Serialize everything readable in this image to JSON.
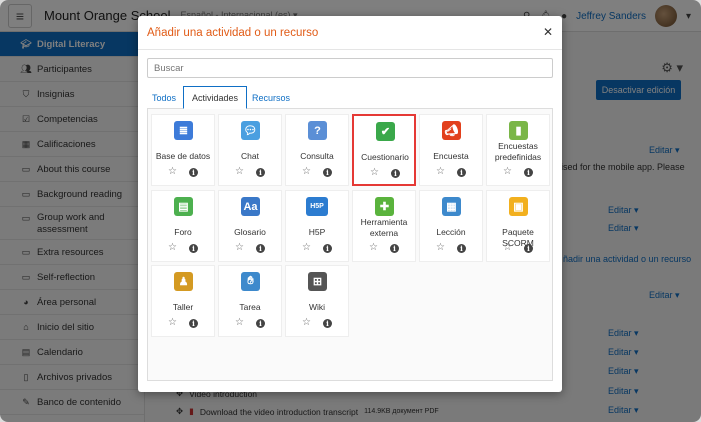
{
  "navbar": {
    "site_name": "Mount Orange School",
    "language": "Español - Internacional (es) ▾",
    "user": "Jeffrey Sanders"
  },
  "sidebar": {
    "items": [
      {
        "label": "Digital Literacy",
        "icon": "graduation-cap-icon",
        "active": true
      },
      {
        "label": "Participantes",
        "icon": "users-icon"
      },
      {
        "label": "Insignias",
        "icon": "shield-icon"
      },
      {
        "label": "Competencias",
        "icon": "check-square-icon"
      },
      {
        "label": "Calificaciones",
        "icon": "table-icon"
      },
      {
        "label": "About this course",
        "icon": "folder-icon"
      },
      {
        "label": "Background reading",
        "icon": "folder-icon"
      },
      {
        "label": "Group work and assessment",
        "icon": "folder-icon"
      },
      {
        "label": "Extra resources",
        "icon": "folder-icon"
      },
      {
        "label": "Self-reflection",
        "icon": "folder-icon"
      },
      {
        "label": "Área personal",
        "icon": "dashboard-icon"
      },
      {
        "label": "Inicio del sitio",
        "icon": "home-icon"
      },
      {
        "label": "Calendario",
        "icon": "calendar-icon"
      },
      {
        "label": "Archivos privados",
        "icon": "file-icon"
      },
      {
        "label": "Banco de contenido",
        "icon": "brush-icon"
      }
    ]
  },
  "background": {
    "edit_mode_button": "Desactivar edición",
    "edit_label": "Editar ▾",
    "mobile_text": "ised for the mobile app. Please",
    "add_activity_text": "ñadir una actividad o un recurso",
    "video_intro": "Video introduction",
    "transcript": "Download the video introduction transcript",
    "transcript_meta": "114.9KB документ PDF"
  },
  "modal": {
    "title": "Añadir una actividad o un recurso",
    "search_placeholder": "Buscar",
    "tabs": [
      "Todos",
      "Actividades",
      "Recursos"
    ],
    "active_tab": "Actividades",
    "star": "☆",
    "info": "i",
    "activities": [
      {
        "label": "Base de datos",
        "icon": "database-icon",
        "color": "#3d7bd9"
      },
      {
        "label": "Chat",
        "icon": "chat-icon",
        "color": "#4a9fe0"
      },
      {
        "label": "Consulta",
        "icon": "question-icon",
        "color": "#5b8fd6"
      },
      {
        "label": "Cuestionario",
        "icon": "quiz-icon",
        "color": "#3aa84a",
        "selected": true
      },
      {
        "label": "Encuesta",
        "icon": "megaphone-icon",
        "color": "#e2401c"
      },
      {
        "label": "Encuestas predefinidas",
        "icon": "bar-chart-icon",
        "color": "#7ab648"
      },
      {
        "label": "Foro",
        "icon": "forum-icon",
        "color": "#4db04f"
      },
      {
        "label": "Glosario",
        "icon": "glossary-icon",
        "color": "#3a78c8"
      },
      {
        "label": "H5P",
        "icon": "h5p-icon",
        "color": "#2c7cd0"
      },
      {
        "label": "Herramienta externa",
        "icon": "puzzle-icon",
        "color": "#5ab33d"
      },
      {
        "label": "Lección",
        "icon": "lesson-icon",
        "color": "#3d89cc"
      },
      {
        "label": "Paquete SCORM",
        "icon": "scorm-icon",
        "color": "#f2b01e"
      },
      {
        "label": "Taller",
        "icon": "workshop-icon",
        "color": "#d49a22"
      },
      {
        "label": "Tarea",
        "icon": "assignment-icon",
        "color": "#3d89cc"
      },
      {
        "label": "Wiki",
        "icon": "wiki-icon",
        "color": "#555555"
      }
    ]
  }
}
